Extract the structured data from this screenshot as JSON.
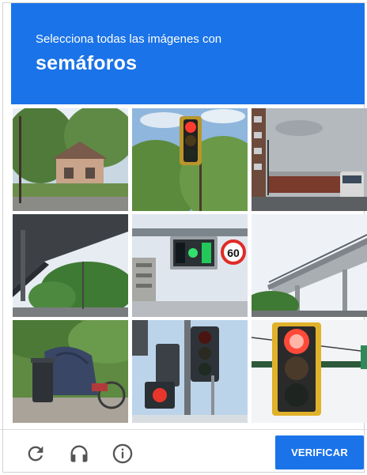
{
  "header": {
    "instruction": "Selecciona todas las imágenes con",
    "target": "semáforos"
  },
  "colors": {
    "accent": "#1a73e8",
    "text_on_accent": "#ffffff",
    "icon": "#555555"
  },
  "tiles": [
    {
      "scene": "street-houses-trees"
    },
    {
      "scene": "traffic-light-red-trees"
    },
    {
      "scene": "road-building-bus"
    },
    {
      "scene": "highway-underpass"
    },
    {
      "scene": "traffic-light-green-60-sign"
    },
    {
      "scene": "highway-overpass"
    },
    {
      "scene": "covered-motorbikes-bins"
    },
    {
      "scene": "traffic-lights-red-pole"
    },
    {
      "scene": "traffic-light-red-closeup"
    }
  ],
  "speed_sign": "60",
  "footer": {
    "reload_icon": "reload-icon",
    "audio_icon": "headphones-icon",
    "info_icon": "info-icon",
    "verify_label": "VERIFICAR"
  }
}
